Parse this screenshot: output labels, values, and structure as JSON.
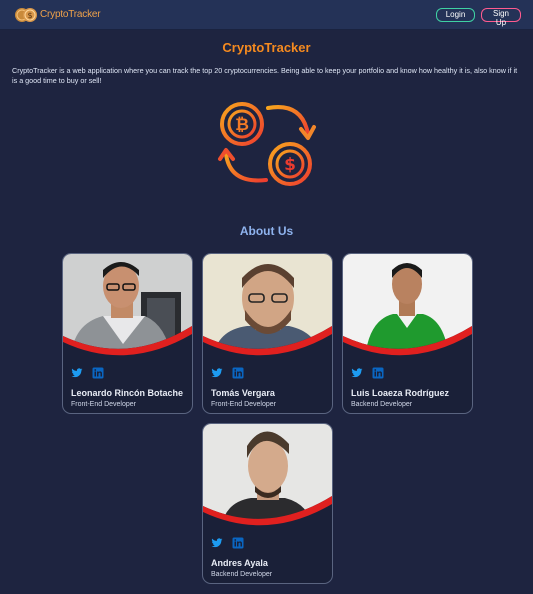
{
  "navbar": {
    "brand": "CryptoTracker",
    "login_label": "Login",
    "signup_label": "Sign Up"
  },
  "hero": {
    "title": "CryptoTracker",
    "description": "CryptoTracker is a web application where you can track the top 20 cryptocurrencies. Being able to keep your portfolio and know how healthy it is, also know if it is a good time to buy or sell!",
    "icon": "bitcoin-dollar-exchange-icon"
  },
  "about": {
    "heading": "About Us",
    "members": [
      {
        "name": "Leonardo Rincón Botache",
        "role": "Front-End Developer",
        "photo": "portrait-photo",
        "socials": [
          "twitter-icon",
          "linkedin-icon"
        ]
      },
      {
        "name": "Tomás Vergara",
        "role": "Front-End Developer",
        "photo": "portrait-photo",
        "socials": [
          "twitter-icon",
          "linkedin-icon"
        ]
      },
      {
        "name": "Luis Loaeza Rodríguez",
        "role": "Backend Developer",
        "photo": "portrait-photo",
        "socials": [
          "twitter-icon",
          "linkedin-icon"
        ]
      },
      {
        "name": "Andres Ayala",
        "role": "Backend Developer",
        "photo": "portrait-photo",
        "socials": [
          "twitter-icon",
          "linkedin-icon"
        ]
      }
    ]
  },
  "colors": {
    "background": "#1e2440",
    "navbar": "#243257",
    "accent_orange": "#f58a1f",
    "login_border": "#3fd1a3",
    "signup_border": "#ff5b8f",
    "about_heading": "#8fb3ee",
    "card_wave": "#e0201f",
    "twitter": "#1d9bf0",
    "linkedin": "#0a66c2"
  }
}
